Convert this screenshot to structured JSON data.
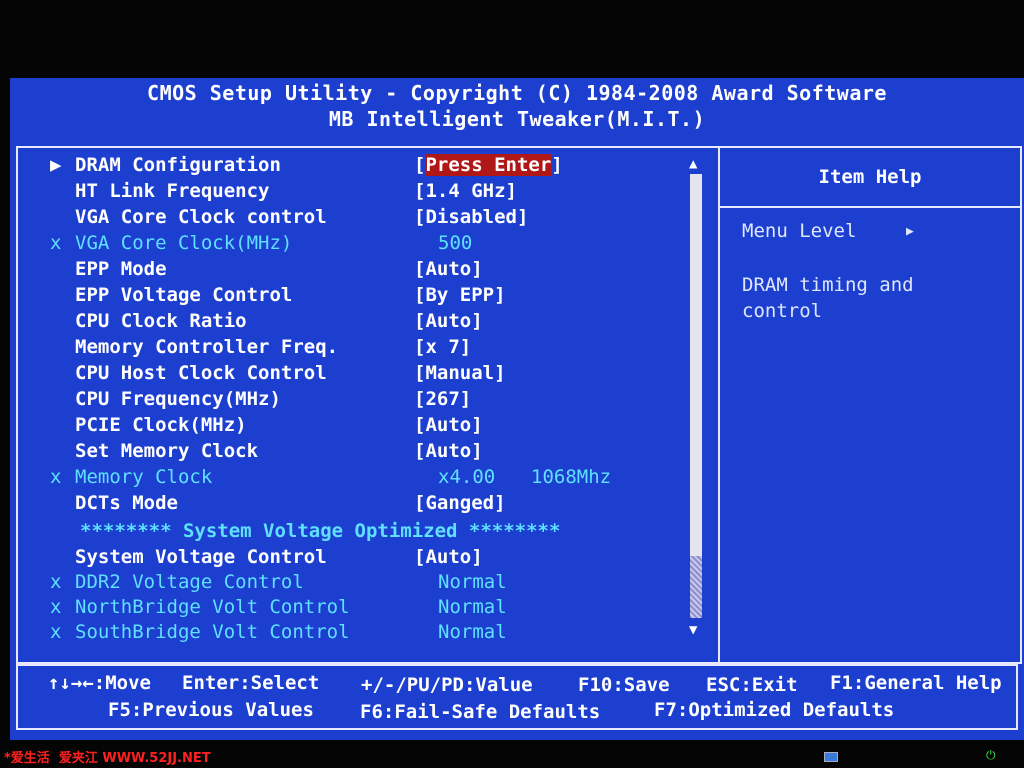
{
  "header": {
    "title_line1": "CMOS Setup Utility - Copyright (C) 1984-2008 Award Software",
    "title_line2": "MB Intelligent Tweaker(M.I.T.)"
  },
  "menu": [
    {
      "marker": "▶",
      "label": "DRAM Configuration",
      "value_open": "[",
      "value": "Press Enter",
      "value_close": "]",
      "selected": true,
      "disabled": false
    },
    {
      "marker": "",
      "label": "HT Link Frequency",
      "value_open": "",
      "value": "[1.4 GHz]",
      "value_close": "",
      "disabled": false
    },
    {
      "marker": "",
      "label": "VGA Core Clock control",
      "value_open": "",
      "value": "[Disabled]",
      "value_close": "",
      "disabled": false
    },
    {
      "marker": "x",
      "label": "VGA Core Clock(MHz)",
      "value_open": "",
      "value": "500",
      "value_close": "",
      "disabled": true
    },
    {
      "marker": "",
      "label": "EPP Mode",
      "value_open": "",
      "value": "[Auto]",
      "value_close": "",
      "disabled": false
    },
    {
      "marker": "",
      "label": "EPP Voltage Control",
      "value_open": "",
      "value": "[By EPP]",
      "value_close": "",
      "disabled": false
    },
    {
      "marker": "",
      "label": "CPU Clock Ratio",
      "value_open": "",
      "value": "[Auto]",
      "value_close": "",
      "disabled": false
    },
    {
      "marker": "",
      "label": "Memory Controller Freq.",
      "value_open": "",
      "value": "[x 7]",
      "value_close": "",
      "disabled": false
    },
    {
      "marker": "",
      "label": "CPU Host Clock Control",
      "value_open": "",
      "value": "[Manual]",
      "value_close": "",
      "disabled": false
    },
    {
      "marker": "",
      "label": "CPU Frequency(MHz)",
      "value_open": "",
      "value": "[267]",
      "value_close": "",
      "disabled": false
    },
    {
      "marker": "",
      "label": "PCIE Clock(MHz)",
      "value_open": "",
      "value": "[Auto]",
      "value_close": "",
      "disabled": false
    },
    {
      "marker": "",
      "label": "Set Memory Clock",
      "value_open": "",
      "value": "[Auto]",
      "value_close": "",
      "disabled": false
    },
    {
      "marker": "x",
      "label": "Memory Clock",
      "value_open": "",
      "value": "x4.00",
      "value2": "1068Mhz",
      "value_close": "",
      "disabled": true
    },
    {
      "marker": "",
      "label": "DCTs Mode",
      "value_open": "",
      "value": "[Ganged]",
      "value_close": "",
      "disabled": false
    },
    {
      "marker": "",
      "label": "******** System Voltage Optimized ********",
      "section": true
    },
    {
      "marker": "",
      "label": "System Voltage Control",
      "value_open": "",
      "value": "[Auto]",
      "value_close": "",
      "disabled": false
    },
    {
      "marker": "x",
      "label": "DDR2 Voltage Control",
      "value_open": "",
      "value": "Normal",
      "value_close": "",
      "disabled": true
    },
    {
      "marker": "x",
      "label": "NorthBridge Volt Control",
      "value_open": "",
      "value": "Normal",
      "value_close": "",
      "disabled": true
    },
    {
      "marker": "x",
      "label": "SouthBridge Volt Control",
      "value_open": "",
      "value": "Normal",
      "value_close": "",
      "disabled": true
    }
  ],
  "help": {
    "title": "Item Help",
    "menu_level": "Menu Level",
    "menu_level_marker": "▶",
    "text": "DRAM timing and\ncontrol"
  },
  "scrollbar": {
    "up": "▲",
    "down": "▼"
  },
  "footer": {
    "move": "↑↓→←:Move",
    "enter": "Enter:Select",
    "value": "+/-/PU/PD:Value",
    "f10": "F10:Save",
    "esc": "ESC:Exit",
    "f1": "F1:General Help",
    "f5": "F5:Previous Values",
    "f6": "F6:Fail-Safe Defaults",
    "f7": "F7:Optimized Defaults"
  },
  "watermark": "*爱生活  爱夹江 WWW.52JJ.NET"
}
